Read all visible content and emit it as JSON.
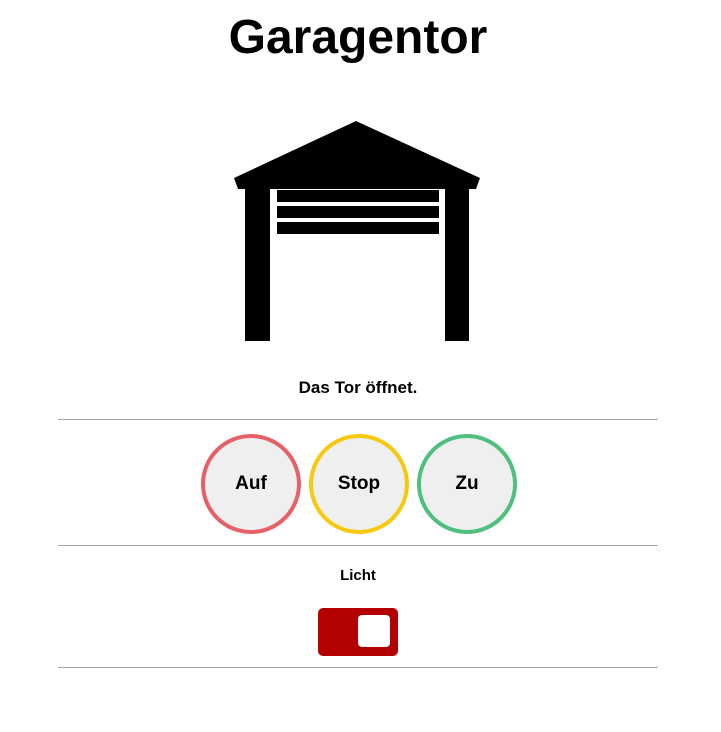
{
  "page": {
    "title": "Garagentor"
  },
  "garage": {
    "icon": "garage-icon",
    "status_text": "Das Tor öffnet."
  },
  "controls": {
    "buttons": [
      {
        "label": "Auf",
        "color": "#e66067"
      },
      {
        "label": "Stop",
        "color": "#f7c90e"
      },
      {
        "label": "Zu",
        "color": "#4fbf7e"
      }
    ]
  },
  "light": {
    "label": "Licht",
    "state": "on",
    "color": "#b30000"
  }
}
